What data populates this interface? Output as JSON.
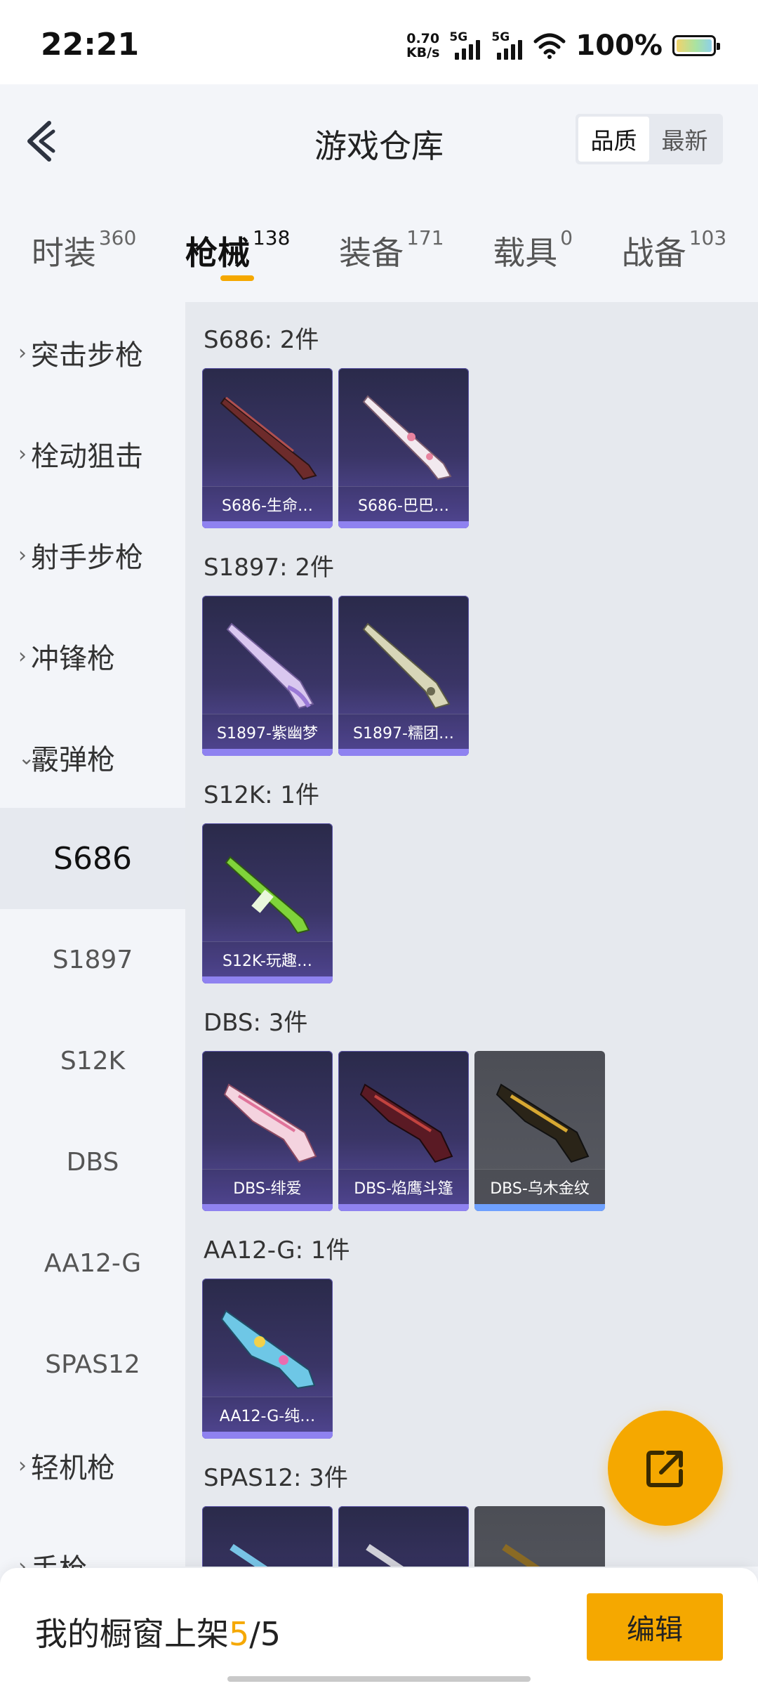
{
  "status": {
    "time": "22:21",
    "net_speed_value": "0.70",
    "net_speed_unit": "KB/s",
    "signal1": "5G",
    "signal2": "5G",
    "battery": "100%"
  },
  "header": {
    "title": "游戏仓库",
    "sort_options": [
      "品质",
      "最新"
    ]
  },
  "tabs": [
    {
      "label": "时装",
      "count": "360"
    },
    {
      "label": "枪械",
      "count": "138"
    },
    {
      "label": "装备",
      "count": "171"
    },
    {
      "label": "载具",
      "count": "0"
    },
    {
      "label": "战备",
      "count": "103"
    }
  ],
  "sidebar": {
    "categories": [
      "突击步枪",
      "栓动狙击",
      "射手步枪",
      "冲锋枪",
      "霰弹枪"
    ],
    "subcategories": [
      "S686",
      "S1897",
      "S12K",
      "DBS",
      "AA12-G",
      "SPAS12"
    ],
    "after": [
      "轻机枪",
      "手枪"
    ]
  },
  "groups": [
    {
      "title": "S686: 2件",
      "items": [
        "S686-生命…",
        "S686-巴巴…"
      ]
    },
    {
      "title": "S1897: 2件",
      "items": [
        "S1897-紫幽梦",
        "S1897-糯团…"
      ]
    },
    {
      "title": "S12K: 1件",
      "items": [
        "S12K-玩趣…"
      ]
    },
    {
      "title": "DBS: 3件",
      "items": [
        "DBS-绯爱",
        "DBS-焰鹰斗篷",
        "DBS-乌木金纹"
      ]
    },
    {
      "title": "AA12-G: 1件",
      "items": [
        "AA12-G-纯…"
      ]
    },
    {
      "title": "SPAS12: 3件",
      "items": []
    }
  ],
  "bottom": {
    "shelf_label": "我的橱窗上架",
    "shelf_count": "5",
    "shelf_total": "/5",
    "edit_label": "编辑"
  },
  "colors": {
    "accent": "#f5a800",
    "card_purple": "#3a3566",
    "card_gray": "#585a62"
  }
}
